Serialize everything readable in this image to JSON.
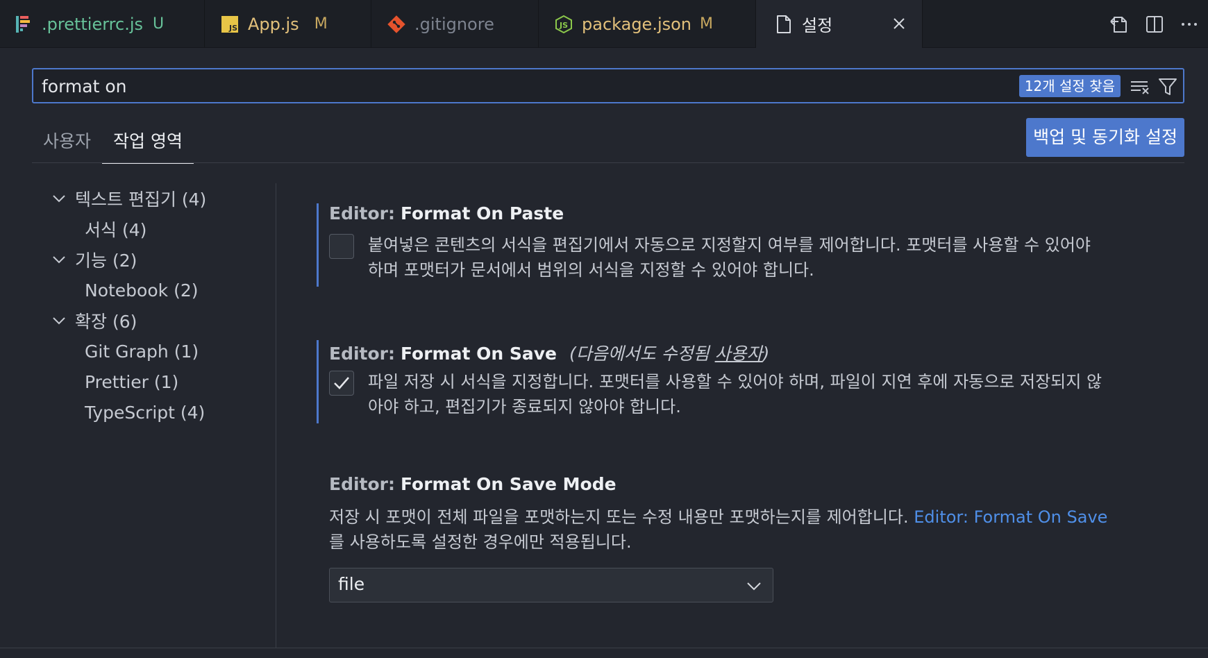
{
  "tabs": [
    {
      "label": ".prettierrc.js",
      "status": "U",
      "icon": "prettier-icon",
      "color": "#67c199",
      "status_color": "#67c199"
    },
    {
      "label": "App.js",
      "status": "M",
      "icon": "js-file-icon",
      "color": "#e2c07b",
      "status_color": "#c8a860"
    },
    {
      "label": ".gitignore",
      "status": "",
      "icon": "git-icon",
      "color": "#7d838f",
      "status_color": "#7d838f"
    },
    {
      "label": "package.json",
      "status": "M",
      "icon": "node-icon",
      "color": "#e2c07b",
      "status_color": "#c8a860"
    },
    {
      "label": "설정",
      "status": "",
      "icon": "settings-file-icon",
      "color": "#d6d9df",
      "status_color": "#d6d9df",
      "active": true
    }
  ],
  "search": {
    "value": "format on",
    "result_count": "12개 설정 찾음"
  },
  "scope_tabs": [
    "사용자",
    "작업 영역"
  ],
  "active_scope": "작업 영역",
  "backup_button": "백업 및 동기화 설정",
  "toc": [
    {
      "label": "텍스트 편집기 (4)",
      "level": 0,
      "expanded": true
    },
    {
      "label": "서식 (4)",
      "level": 1
    },
    {
      "label": "기능 (2)",
      "level": 0,
      "expanded": true
    },
    {
      "label": "Notebook (2)",
      "level": 1
    },
    {
      "label": "확장 (6)",
      "level": 0,
      "expanded": true
    },
    {
      "label": "Git Graph (1)",
      "level": 1
    },
    {
      "label": "Prettier (1)",
      "level": 1
    },
    {
      "label": "TypeScript (4)",
      "level": 1
    }
  ],
  "settings": {
    "paste": {
      "category": "Editor:",
      "name": "Format On Paste",
      "checked": false,
      "desc_line1": "붙여넣은 콘텐츠의 서식을 편집기에서 자동으로 지정할지 여부를 제어합니다. 포맷터를 사용할 수 있어야",
      "desc_line2": "하며 포맷터가 문서에서 범위의 서식을 지정할 수 있어야 합니다."
    },
    "save": {
      "category": "Editor:",
      "name": "Format On Save",
      "modified_prefix": "(다음에서도 수정됨 ",
      "modified_link": "사용자",
      "modified_suffix": ")",
      "checked": true,
      "desc_line1": "파일 저장 시 서식을 지정합니다. 포맷터를 사용할 수 있어야 하며, 파일이 지연 후에 자동으로 저장되지 않",
      "desc_line2": "아야 하고, 편집기가 종료되지 않아야 합니다."
    },
    "save_mode": {
      "category": "Editor:",
      "name": "Format On Save Mode",
      "desc_line1": "저장 시 포맷이 전체 파일을 포맷하는지 또는 수정 내용만 포맷하는지를 제어합니다. ",
      "desc_link": "Editor: Format On Save",
      "desc_line2": "를 사용하도록 설정한 경우에만 적용됩니다.",
      "value": "file"
    }
  },
  "colors": {
    "accent": "#4d78cc",
    "link": "#4f8fe8",
    "background": "#23262e",
    "tabbar": "#1c1f25"
  }
}
